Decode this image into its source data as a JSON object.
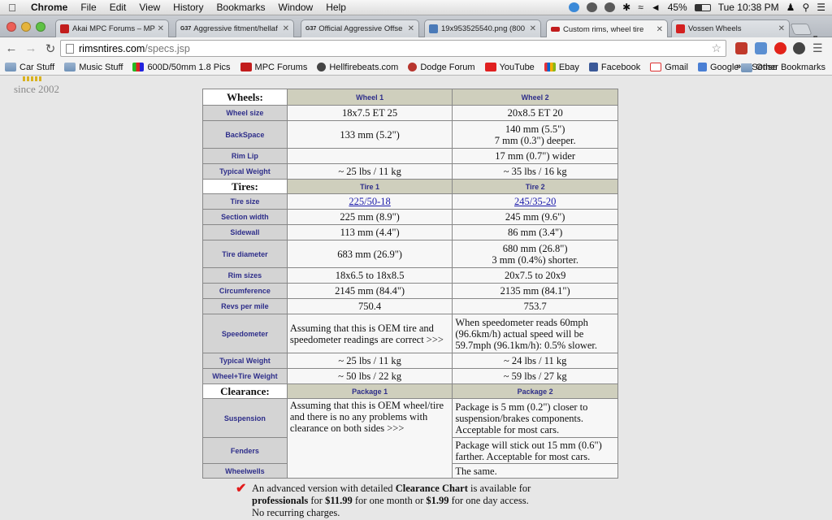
{
  "menubar": {
    "app": "Chrome",
    "items": [
      "File",
      "Edit",
      "View",
      "History",
      "Bookmarks",
      "Window",
      "Help"
    ],
    "battery": "45%",
    "clock": "Tue 10:38 PM"
  },
  "tabs": [
    {
      "title": "Akai MPC Forums – MPC",
      "favicon_color": "#c21d1d"
    },
    {
      "title": "Aggressive fitment/hellaf",
      "favicon_color": "#333333",
      "prefix": "G37"
    },
    {
      "title": "Official Aggressive Offse",
      "favicon_color": "#333333",
      "prefix": "G37"
    },
    {
      "title": "19x953525540.png (800",
      "favicon_color": "#4a7ab8"
    },
    {
      "title": "Custom rims, wheel tire",
      "favicon_color": "#c21d1d",
      "active": true
    },
    {
      "title": "Vossen Wheels",
      "favicon_color": "#d32020"
    }
  ],
  "toolbar": {
    "url_host": "rimsntires.com",
    "url_path": "/specs.jsp"
  },
  "bookmarks": [
    {
      "label": "Car Stuff",
      "icon": "folder-icon"
    },
    {
      "label": "Music Stuff",
      "icon": "folder-icon"
    },
    {
      "label": "600D/50mm 1.8 Pics",
      "icon": "pics-icon"
    },
    {
      "label": "MPC Forums",
      "icon": "mpc-icon"
    },
    {
      "label": "Hellfirebeats.com",
      "icon": "hellfire-icon"
    },
    {
      "label": "Dodge Forum",
      "icon": "dodge-icon"
    },
    {
      "label": "YouTube",
      "icon": "youtube-icon"
    },
    {
      "label": "Ebay",
      "icon": "ebay-icon"
    },
    {
      "label": "Facebook",
      "icon": "facebook-icon"
    },
    {
      "label": "Gmail",
      "icon": "gmail-icon"
    },
    {
      "label": "Google AdSense",
      "icon": "adsense-icon"
    }
  ],
  "bookmarks_chevron": "»",
  "bookmarks_other": "Other Bookmarks",
  "page": {
    "since": "since 2002",
    "wheels": {
      "section": "Wheels:",
      "col1": "Wheel 1",
      "col2": "Wheel 2",
      "rows": [
        {
          "label": "Wheel size",
          "v1": "18x7.5 ET 25",
          "v2": "20x8.5 ET 20"
        },
        {
          "label": "BackSpace",
          "v1": "133 mm (5.2\")",
          "v2a": "140 mm (5.5\")",
          "v2b": "7 mm (0.3\") deeper."
        },
        {
          "label": "Rim Lip",
          "v1": "",
          "v2": "17 mm (0.7\") wider"
        },
        {
          "label": "Typical Weight",
          "v1": "~ 25 lbs / 11 kg",
          "v2": "~ 35 lbs / 16 kg"
        }
      ]
    },
    "tires": {
      "section": "Tires:",
      "col1": "Tire 1",
      "col2": "Tire 2",
      "size_label": "Tire size",
      "size1": "225/50-18",
      "size2": "245/35-20",
      "section_width": {
        "label": "Section width",
        "v1": "225 mm (8.9\")",
        "v2": "245 mm (9.6\")"
      },
      "sidewall": {
        "label": "Sidewall",
        "v1": "113 mm (4.4\")",
        "v2": "86 mm (3.4\")"
      },
      "diameter": {
        "label": "Tire diameter",
        "v1": "683 mm (26.9\")",
        "v2a": "680 mm (26.8\")",
        "v2b": "3 mm (0.4%) shorter."
      },
      "rim_sizes": {
        "label": "Rim sizes",
        "v1": "18x6.5 to 18x8.5",
        "v2": "20x7.5 to 20x9"
      },
      "circumference": {
        "label": "Circumference",
        "v1": "2145 mm (84.4\")",
        "v2": "2135 mm (84.1\")"
      },
      "revs": {
        "label": "Revs per mile",
        "v1": "750.4",
        "v2": "753.7"
      },
      "speedometer": {
        "label": "Speedometer",
        "v1": "Assuming that this is OEM tire and speedometer readings are correct >>>",
        "v2": "When speedometer reads 60mph (96.6km/h) actual speed will be 59.7mph (96.1km/h): 0.5% slower."
      },
      "weight": {
        "label": "Typical Weight",
        "v1": "~ 25 lbs / 11 kg",
        "v2": "~ 24 lbs / 11 kg"
      },
      "combined": {
        "label": "Wheel+Tire Weight",
        "v1": "~ 50 lbs / 22 kg",
        "v2": "~ 59 lbs / 27 kg"
      }
    },
    "clearance": {
      "section": "Clearance:",
      "col1": "Package 1",
      "col2": "Package 2",
      "suspension_label": "Suspension",
      "fenders_label": "Fenders",
      "wheelwells_label": "Wheelwells",
      "p1_note": "Assuming that this is OEM wheel/tire and there is no any problems with clearance on both sides >>>",
      "suspension": "Package is 5 mm (0.2\") closer to suspension/brakes components. Acceptable for most cars.",
      "fenders": "Package will stick out 15 mm (0.6\") farther. Acceptable for most cars.",
      "wheelwells": "The same."
    },
    "note": {
      "t1": "An advanced version with detailed ",
      "t2": "Clearance Chart",
      "t3": " is available for ",
      "t4": "professionals",
      "t5": " for ",
      "t6": "$11.99",
      "t7": " for one month or ",
      "t8": "$1.99",
      "t9": " for one day access.",
      "t10": "No recurring charges."
    }
  }
}
